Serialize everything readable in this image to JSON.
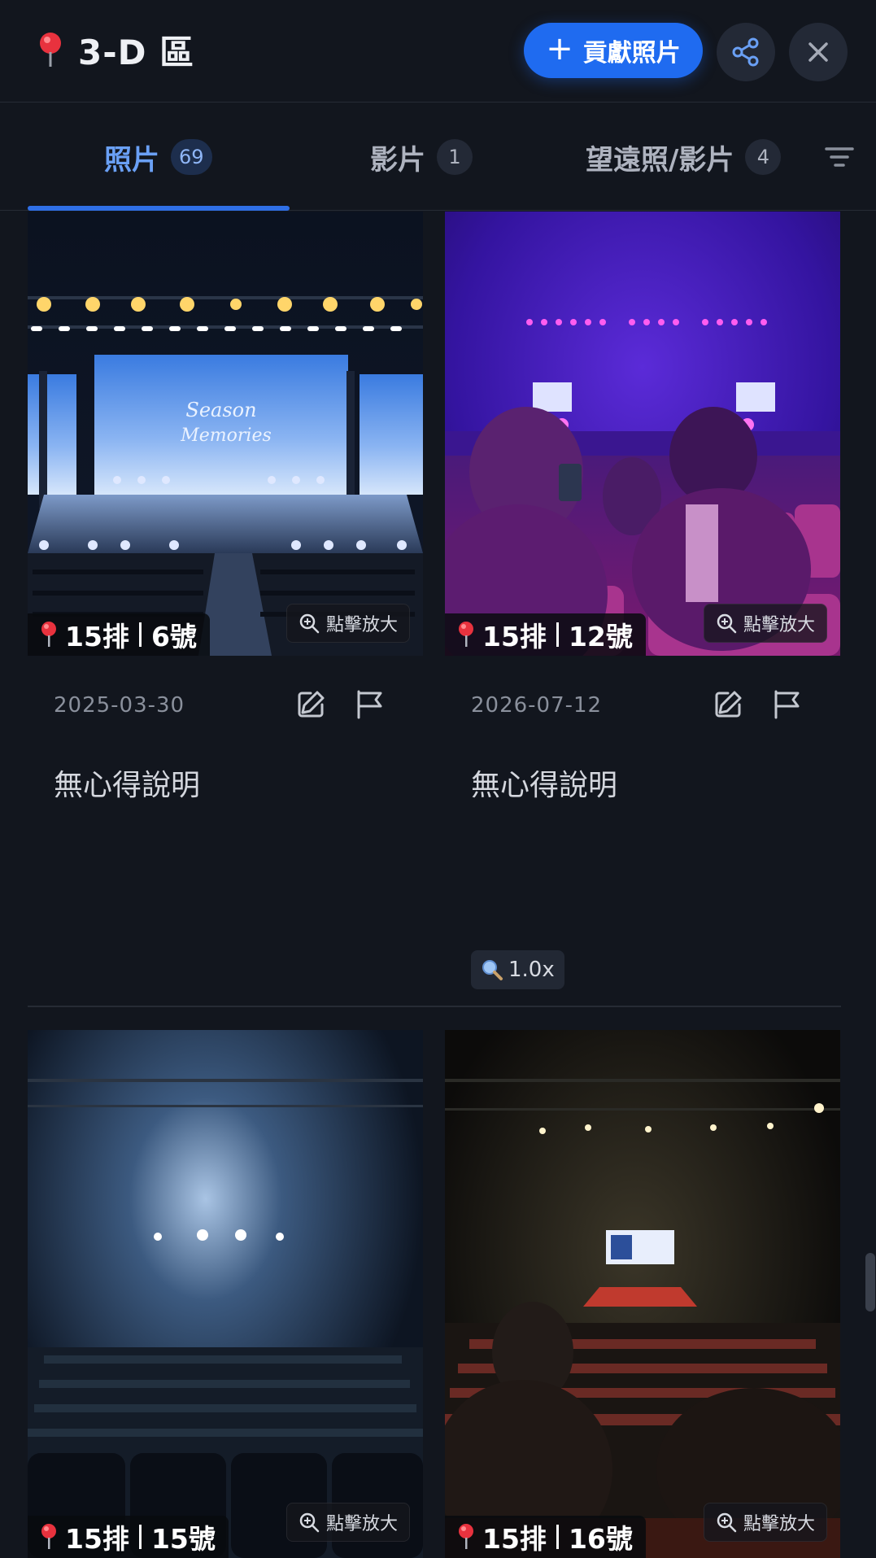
{
  "header": {
    "title": "3-D 區",
    "contribute_label": "貢獻照片",
    "contribute_icon": "plus-icon",
    "share_icon": "share-icon",
    "close_icon": "close-icon"
  },
  "tabs": [
    {
      "label": "照片",
      "count": "69",
      "active": true
    },
    {
      "label": "影片",
      "count": "1",
      "active": false
    },
    {
      "label": "望遠照/影片",
      "count": "4",
      "active": false
    }
  ],
  "filter_icon": "filter-icon",
  "photos": [
    {
      "row": "15排",
      "seat": "6號",
      "zoom_hint": "點擊放大",
      "date": "2025-03-30",
      "note": "無心得說明"
    },
    {
      "row": "15排",
      "seat": "12號",
      "zoom_hint": "點擊放大",
      "date": "2026-07-12",
      "note": "無心得說明",
      "zoom_level": "1.0x"
    },
    {
      "row": "15排",
      "seat": "15號",
      "zoom_hint": "點擊放大"
    },
    {
      "row": "15排",
      "seat": "16號",
      "zoom_hint": "點擊放大"
    }
  ],
  "colors": {
    "accent": "#1f6bf0",
    "background": "#12161e",
    "active_tab": "#6aa0f5"
  }
}
